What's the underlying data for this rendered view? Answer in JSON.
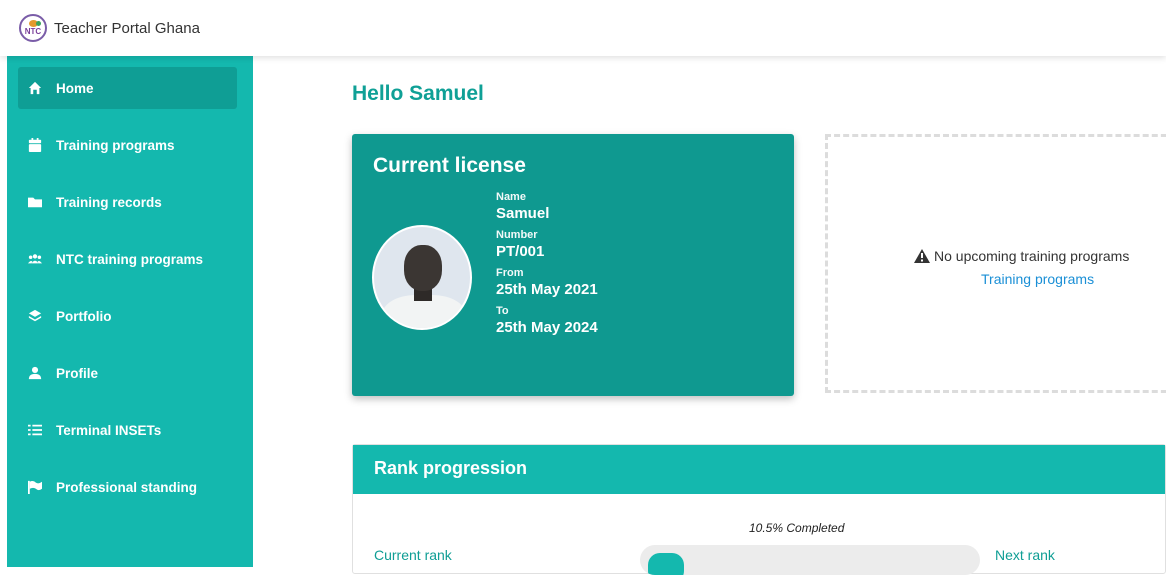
{
  "app": {
    "title": "Teacher Portal Ghana",
    "logo_text": "NTC"
  },
  "sidebar": {
    "items": [
      {
        "label": "Home",
        "icon": "home-icon",
        "active": true
      },
      {
        "label": "Training programs",
        "icon": "calendar-icon",
        "active": false
      },
      {
        "label": "Training records",
        "icon": "folder-icon",
        "active": false
      },
      {
        "label": "NTC training programs",
        "icon": "users-icon",
        "active": false
      },
      {
        "label": "Portfolio",
        "icon": "layers-icon",
        "active": false
      },
      {
        "label": "Profile",
        "icon": "user-icon",
        "active": false
      },
      {
        "label": "Terminal INSETs",
        "icon": "list-icon",
        "active": false
      },
      {
        "label": "Professional standing",
        "icon": "flag-icon",
        "active": false
      }
    ]
  },
  "main": {
    "greeting": "Hello Samuel",
    "license": {
      "title": "Current license",
      "name_label": "Name",
      "name": "Samuel",
      "number_label": "Number",
      "number": "PT/001",
      "from_label": "From",
      "from": "25th May 2021",
      "to_label": "To",
      "to": "25th May 2024"
    },
    "upcoming": {
      "message": "No upcoming training programs",
      "link": "Training programs"
    },
    "rank": {
      "title": "Rank progression",
      "completed_text": "10.5% Completed",
      "progress_fraction": 0.105,
      "current_rank_label": "Current rank",
      "next_rank_label": "Next rank"
    }
  },
  "colors": {
    "accent": "#14b8ae",
    "accent_dark": "#0f9990",
    "link": "#1a8fd6"
  }
}
